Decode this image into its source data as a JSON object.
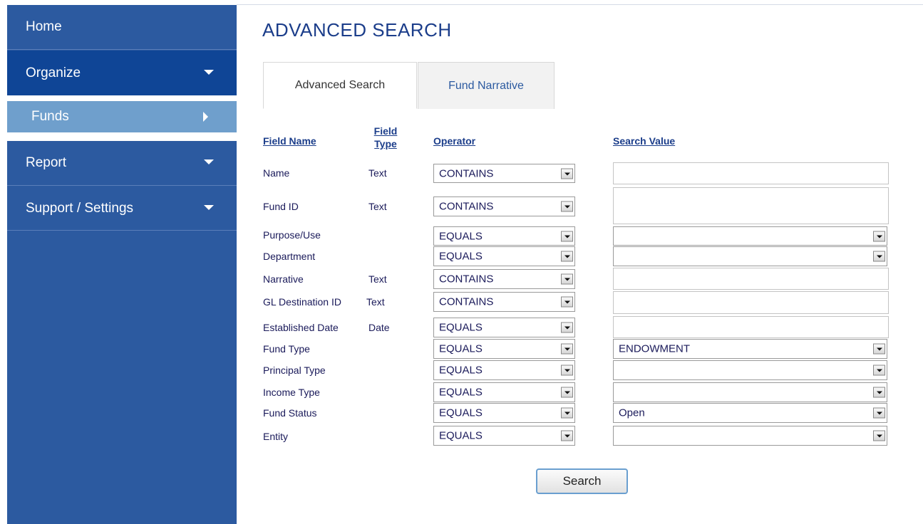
{
  "sidebar": {
    "items": [
      {
        "label": "Home"
      },
      {
        "label": "Organize"
      },
      {
        "label": "Funds"
      },
      {
        "label": "Report"
      },
      {
        "label": "Support / Settings"
      }
    ]
  },
  "page": {
    "title": "ADVANCED SEARCH"
  },
  "tabs": [
    {
      "label": "Advanced Search",
      "active": true
    },
    {
      "label": "Fund Narrative",
      "active": false
    }
  ],
  "columns": {
    "field_name": "Field Name",
    "field_type": "Field Type",
    "operator": "Operator",
    "search_value": "Search Value"
  },
  "rows": [
    {
      "field": "Name",
      "type": "Text",
      "operator": "CONTAINS",
      "value": ""
    },
    {
      "field": "Fund ID",
      "type": "Text",
      "operator": "CONTAINS",
      "value": ""
    },
    {
      "field": "Purpose/Use",
      "type": "",
      "operator": "EQUALS",
      "value": ""
    },
    {
      "field": "Department",
      "type": "",
      "operator": "EQUALS",
      "value": ""
    },
    {
      "field": "Narrative",
      "type": "Text",
      "operator": "CONTAINS",
      "value": ""
    },
    {
      "field": "GL Destination ID",
      "type": "Text",
      "operator": "CONTAINS",
      "value": ""
    },
    {
      "field": "Established Date",
      "type": "Date",
      "operator": "EQUALS",
      "value": ""
    },
    {
      "field": "Fund Type",
      "type": "",
      "operator": "EQUALS",
      "value": "ENDOWMENT"
    },
    {
      "field": "Principal Type",
      "type": "",
      "operator": "EQUALS",
      "value": ""
    },
    {
      "field": "Income Type",
      "type": "",
      "operator": "EQUALS",
      "value": ""
    },
    {
      "field": "Fund Status",
      "type": "",
      "operator": "EQUALS",
      "value": "Open"
    },
    {
      "field": "Entity",
      "type": "",
      "operator": "EQUALS",
      "value": ""
    }
  ],
  "actions": {
    "search_label": "Search"
  },
  "colors": {
    "sidebar_bg": "#2c5aa0",
    "sidebar_active": "#0f4596",
    "sidebar_selected": "#6f9fcc",
    "title": "#1b3d8a"
  }
}
